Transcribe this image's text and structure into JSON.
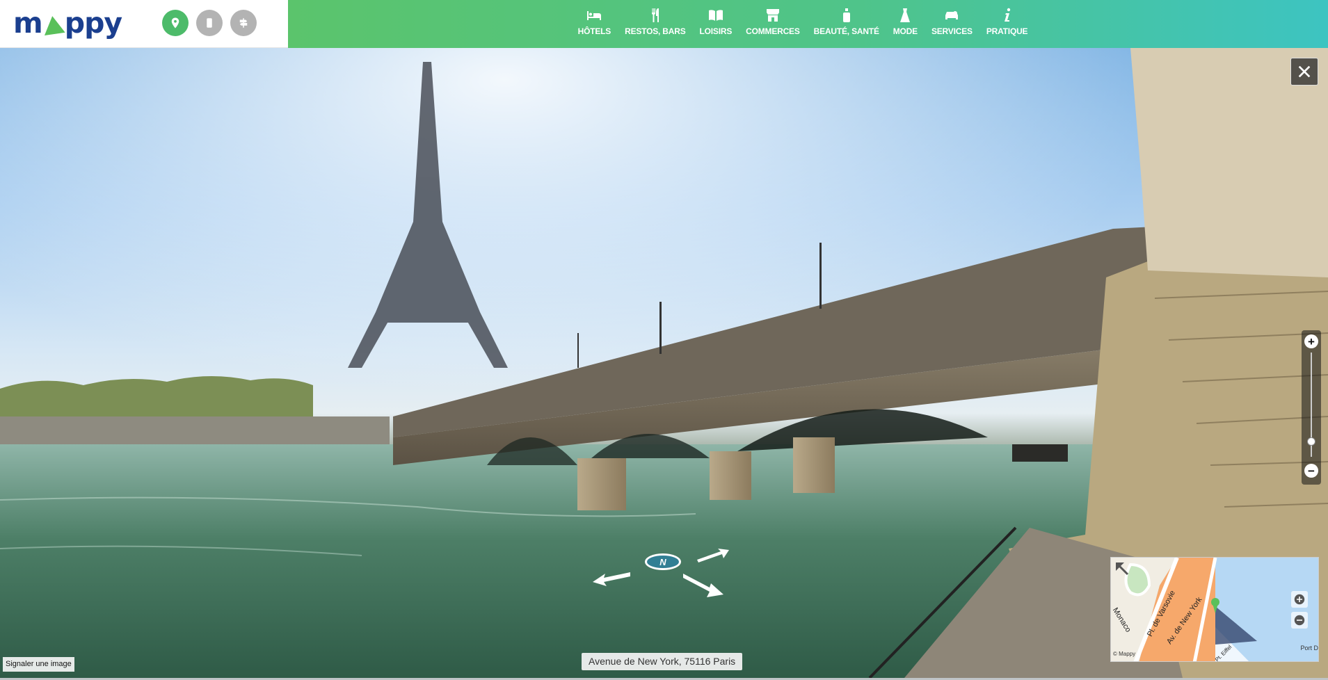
{
  "brand": {
    "logo_text_left": "m",
    "logo_text_right": "ppy"
  },
  "mode_buttons": [
    {
      "name": "map-mode",
      "icon": "location-pin-icon",
      "active": true
    },
    {
      "name": "itinerary-mode",
      "icon": "phone-icon",
      "active": false
    },
    {
      "name": "street-view-mode",
      "icon": "signpost-icon",
      "active": false
    }
  ],
  "categories": [
    {
      "label": "HÔTELS",
      "icon": "bed-icon"
    },
    {
      "label": "RESTOS, BARS",
      "icon": "fork-knife-icon"
    },
    {
      "label": "LOISIRS",
      "icon": "book-icon"
    },
    {
      "label": "COMMERCES",
      "icon": "shop-icon"
    },
    {
      "label": "BEAUTÉ, SANTÉ",
      "icon": "bottle-icon"
    },
    {
      "label": "MODE",
      "icon": "dress-icon"
    },
    {
      "label": "SERVICES",
      "icon": "car-service-icon"
    },
    {
      "label": "PRATIQUE",
      "icon": "info-icon"
    }
  ],
  "panorama": {
    "address": "Avenue de New York, 75116 Paris",
    "report_label": "Signaler une image",
    "compass_label": "N",
    "zoom_level": 0.15
  },
  "minimap": {
    "labels": {
      "monaco": "Monaco",
      "varsovie": "Pl. de Varsovie",
      "new_york": "Av. de New York",
      "eiffel": "Pt. Eiffel",
      "port": "Port D"
    },
    "copyright": "© Mappy"
  },
  "colors": {
    "accent_green": "#4dbb6a",
    "brand_blue": "#1b3f8f",
    "nav_gradient_start": "#5bc46c",
    "nav_gradient_end": "#3dc4c1"
  }
}
